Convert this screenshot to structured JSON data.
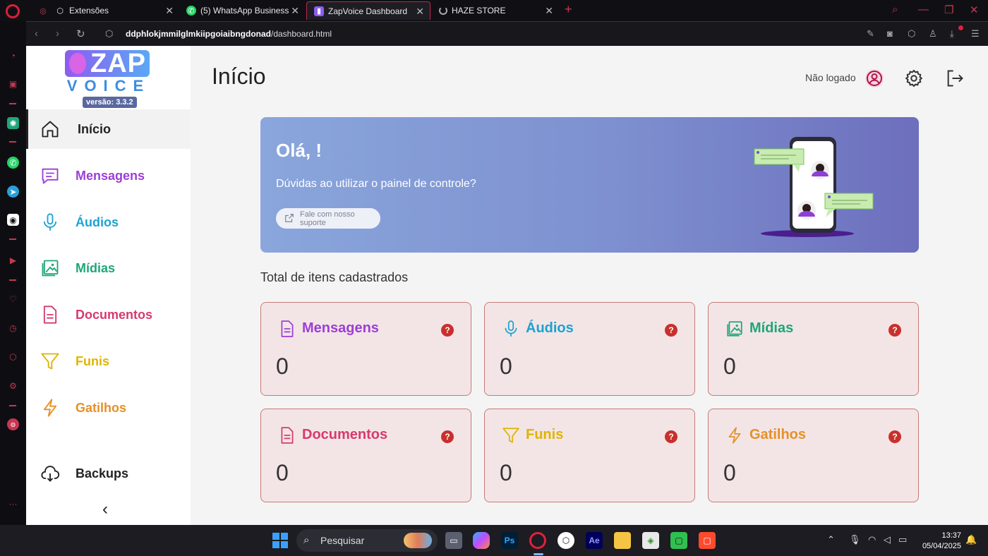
{
  "browser": {
    "tabs": [
      {
        "label": "Extensões",
        "icon": "cube-icon"
      },
      {
        "label": "(5) WhatsApp Business",
        "icon": "whatsapp-icon"
      },
      {
        "label": "ZapVoice Dashboard",
        "icon": "zapvoice-icon",
        "active": true
      },
      {
        "label": "HAZE STORE",
        "icon": "loading-icon"
      }
    ],
    "url_host": "ddphlokjmmilglmkiipgoiaibngdonad",
    "url_path": "/dashboard.html"
  },
  "app": {
    "logo": {
      "top": "ZAP",
      "bottom": "VOICE",
      "version": "versão: 3.3.2"
    },
    "page_title": "Início",
    "user_status": "Não logado",
    "sidebar": {
      "items": [
        {
          "label": "Início",
          "icon": "home-icon",
          "color": "#222222",
          "active": true
        },
        {
          "label": "Mensagens",
          "icon": "message-icon",
          "color": "#9b3fd6"
        },
        {
          "label": "Áudios",
          "icon": "microphone-icon",
          "color": "#1aa3d4"
        },
        {
          "label": "Mídias",
          "icon": "image-icon",
          "color": "#1fa67a"
        },
        {
          "label": "Documentos",
          "icon": "document-icon",
          "color": "#d63a6e"
        },
        {
          "label": "Funis",
          "icon": "funnel-icon",
          "color": "#e0b400"
        },
        {
          "label": "Gatilhos",
          "icon": "lightning-icon",
          "color": "#e5902a"
        },
        {
          "label": "Backups",
          "icon": "cloud-download-icon",
          "color": "#222222"
        }
      ]
    },
    "banner": {
      "greeting": "Olá, !",
      "question": "Dúvidas ao utilizar o painel de controle?",
      "support_button": "Fale com nosso suporte"
    },
    "section_title": "Total de itens cadastrados",
    "cards": [
      {
        "title": "Mensagens",
        "count": "0",
        "color": "#9b3fd6",
        "icon": "document-icon"
      },
      {
        "title": "Áudios",
        "count": "0",
        "color": "#1aa3d4",
        "icon": "microphone-icon"
      },
      {
        "title": "Mídias",
        "count": "0",
        "color": "#1fa67a",
        "icon": "image-icon"
      },
      {
        "title": "Documentos",
        "count": "0",
        "color": "#d63a6e",
        "icon": "document-icon"
      },
      {
        "title": "Funis",
        "count": "0",
        "color": "#e0b400",
        "icon": "funnel-icon"
      },
      {
        "title": "Gatilhos",
        "count": "0",
        "color": "#e5902a",
        "icon": "lightning-icon"
      }
    ],
    "help_glyph": "?"
  },
  "taskbar": {
    "search_placeholder": "Pesquisar",
    "time": "13:37",
    "date": "05/04/2025",
    "apps": [
      "Ps",
      "Ae"
    ]
  }
}
